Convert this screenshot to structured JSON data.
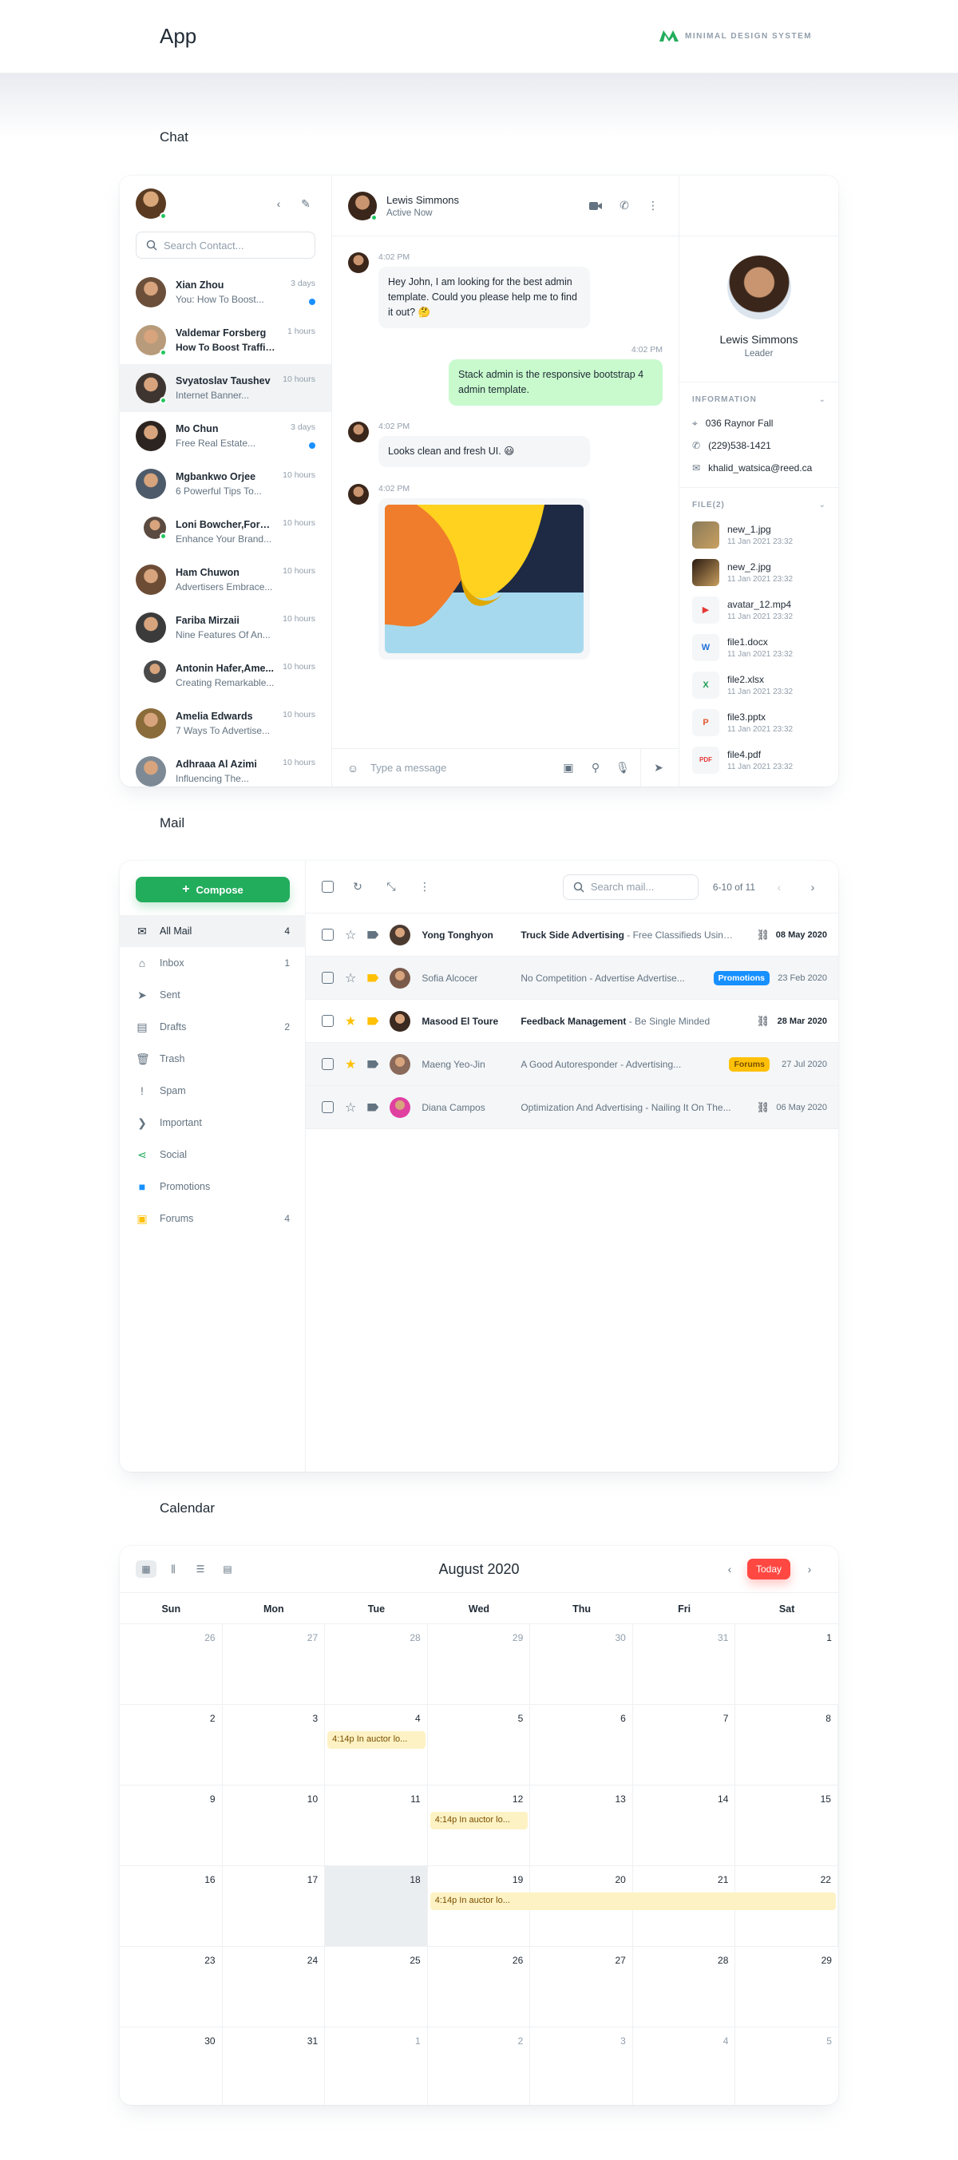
{
  "header": {
    "title": "App",
    "brand": "MINIMAL DESIGN SYSTEM"
  },
  "sections": {
    "chat": "Chat",
    "mail": "Mail",
    "calendar": "Calendar"
  },
  "chat": {
    "search_placeholder": "Search Contact...",
    "contacts": [
      {
        "name": "Xian Zhou",
        "msg": "You: How To Boost...",
        "time": "3 days",
        "unread": true,
        "bold": false,
        "color": "#6b4f3a"
      },
      {
        "name": "Valdemar Forsberg",
        "msg": "How To Boost Traffic...",
        "time": "1 hours",
        "unread": false,
        "bold": true,
        "online": true,
        "color": "#b89b7a"
      },
      {
        "name": "Svyatoslav Taushev",
        "msg": "Internet Banner...",
        "time": "10 hours",
        "unread": false,
        "active": true,
        "online": true,
        "color": "#3e3530"
      },
      {
        "name": "Mo Chun",
        "msg": "Free Real Estate...",
        "time": "3 days",
        "unread": true,
        "color": "#2c2420"
      },
      {
        "name": "Mgbankwo Orjee",
        "msg": "6 Powerful Tips To...",
        "time": "10 hours",
        "color": "#4d5a6a"
      },
      {
        "name": "Loni Bowcher,Forsb...",
        "msg": "Enhance Your Brand...",
        "time": "10 hours",
        "group": true,
        "online": true,
        "color": "#5a4a40"
      },
      {
        "name": "Ham Chuwon",
        "msg": "Advertisers Embrace...",
        "time": "10 hours",
        "color": "#6d4c36"
      },
      {
        "name": "Fariba Mirzaii",
        "msg": "Nine Features Of An...",
        "time": "10 hours",
        "color": "#3b3b3b"
      },
      {
        "name": "Antonin Hafer,Ame...",
        "msg": "Creating Remarkable...",
        "time": "10 hours",
        "group": true,
        "color": "#4a4a4a"
      },
      {
        "name": "Amelia Edwards",
        "msg": "7 Ways To Advertise...",
        "time": "10 hours",
        "color": "#8a6b3a"
      },
      {
        "name": "Adhraaa Al Azimi",
        "msg": "Influencing The...",
        "time": "10 hours",
        "color": "#7d8a95"
      }
    ],
    "conversation": {
      "name": "Lewis Simmons",
      "status": "Active Now",
      "messages": [
        {
          "time": "4:02 PM",
          "text": "Hey John, I am looking for the best admin template. Could you please help me to find it out? 🤔",
          "me": false
        },
        {
          "time": "4:02 PM",
          "text": "Stack admin is the responsive bootstrap 4 admin template.",
          "me": true
        },
        {
          "time": "4:02 PM",
          "text": "Looks clean and fresh UI. 😃",
          "me": false
        },
        {
          "time": "4:02 PM",
          "text": "",
          "me": false,
          "image": true
        }
      ],
      "composer_placeholder": "Type a message"
    },
    "profile": {
      "name": "Lewis Simmons",
      "role": "Leader",
      "info_label": "INFORMATION",
      "address": "036 Raynor Fall",
      "phone": "(229)538-1421",
      "email": "khalid_watsica@reed.ca",
      "files_label": "FILE(2)",
      "files": [
        {
          "name": "new_1.jpg",
          "date": "11 Jan 2021 23:32",
          "kind": "img1",
          "color": "#8a7a5a"
        },
        {
          "name": "new_2.jpg",
          "date": "11 Jan 2021 23:32",
          "kind": "img2",
          "color": "#2a1a10"
        },
        {
          "name": "avatar_12.mp4",
          "date": "11 Jan 2021 23:32",
          "kind": "video",
          "color": "#e53935",
          "glyph": "▶"
        },
        {
          "name": "file1.docx",
          "date": "11 Jan 2021 23:32",
          "kind": "doc",
          "color": "#1e6fd9",
          "glyph": "W"
        },
        {
          "name": "file2.xlsx",
          "date": "11 Jan 2021 23:32",
          "kind": "xls",
          "color": "#1d9d53",
          "glyph": "X"
        },
        {
          "name": "file3.pptx",
          "date": "11 Jan 2021 23:32",
          "kind": "ppt",
          "color": "#e4572e",
          "glyph": "P"
        },
        {
          "name": "file4.pdf",
          "date": "11 Jan 2021 23:32",
          "kind": "pdf",
          "color": "#e53935",
          "glyph": "PDF"
        }
      ]
    }
  },
  "mail": {
    "compose": "Compose",
    "labels": [
      {
        "name": "All Mail",
        "count": "4",
        "icon": "✉",
        "color": "#212b36",
        "active": true
      },
      {
        "name": "Inbox",
        "count": "1",
        "icon": "⌂",
        "color": "#637381"
      },
      {
        "name": "Sent",
        "count": "",
        "icon": "➤",
        "color": "#637381"
      },
      {
        "name": "Drafts",
        "count": "2",
        "icon": "▤",
        "color": "#637381"
      },
      {
        "name": "Trash",
        "count": "",
        "icon": "🗑",
        "color": "#637381"
      },
      {
        "name": "Spam",
        "count": "",
        "icon": "!",
        "color": "#637381"
      },
      {
        "name": "Important",
        "count": "",
        "icon": "❯",
        "color": "#637381"
      },
      {
        "name": "Social",
        "count": "",
        "icon": "⋖",
        "color": "#22ad5c"
      },
      {
        "name": "Promotions",
        "count": "",
        "icon": "■",
        "color": "#1890ff"
      },
      {
        "name": "Forums",
        "count": "4",
        "icon": "▣",
        "color": "#ffc107"
      }
    ],
    "search_placeholder": "Search mail...",
    "pagination": "6-10 of 11",
    "rows": [
      {
        "name": "Yong Tonghyon",
        "subject": "Truck Side Advertising",
        "snippet": " - Free Classifieds Using...",
        "date": "08 May 2020",
        "unread": true,
        "starred": false,
        "tag": "#637381",
        "attach": true,
        "badge": "",
        "badge_color": "",
        "color": "#4a3a30"
      },
      {
        "name": "Sofia Alcocer",
        "subject": "No Competition",
        "snippet": " - Advertise Advertise...",
        "date": "23 Feb 2020",
        "unread": false,
        "starred": false,
        "tag": "#ffc107",
        "attach": false,
        "badge": "Promotions",
        "badge_color": "#1890ff",
        "color": "#7a5a4a"
      },
      {
        "name": "Masood El Toure",
        "subject": "Feedback Management",
        "snippet": " - Be Single Minded",
        "date": "28 Mar 2020",
        "unread": true,
        "starred": true,
        "tag": "#ffc107",
        "attach": true,
        "badge": "",
        "badge_color": "",
        "color": "#3a2a20"
      },
      {
        "name": "Maeng Yeo-Jin",
        "subject": "A Good Autoresponder",
        "snippet": " - Advertising...",
        "date": "27 Jul 2020",
        "unread": false,
        "starred": true,
        "tag": "#637381",
        "attach": false,
        "badge": "Forums",
        "badge_color": "#ffc107",
        "color": "#8a6a5a"
      },
      {
        "name": "Diana Campos",
        "subject": "Optimization And Advertising",
        "snippet": " - Nailing It On The...",
        "date": "06 May 2020",
        "unread": false,
        "starred": false,
        "tag": "#637381",
        "attach": true,
        "badge": "",
        "badge_color": "",
        "color": "#e040a0"
      }
    ]
  },
  "calendar": {
    "title": "August 2020",
    "today": "Today",
    "weekdays": [
      "Sun",
      "Mon",
      "Tue",
      "Wed",
      "Thu",
      "Fri",
      "Sat"
    ],
    "weeks": [
      [
        "26",
        "27",
        "28",
        "29",
        "30",
        "31",
        "1"
      ],
      [
        "2",
        "3",
        "4",
        "5",
        "6",
        "7",
        "8"
      ],
      [
        "9",
        "10",
        "11",
        "12",
        "13",
        "14",
        "15"
      ],
      [
        "16",
        "17",
        "18",
        "19",
        "20",
        "21",
        "22"
      ],
      [
        "23",
        "24",
        "25",
        "26",
        "27",
        "28",
        "29"
      ],
      [
        "30",
        "31",
        "1",
        "2",
        "3",
        "4",
        "5"
      ]
    ],
    "events": [
      {
        "text": "4:14p In auctor lo...",
        "week": 1,
        "start": 2,
        "span": 1
      },
      {
        "text": "4:14p In auctor lo...",
        "week": 2,
        "start": 3,
        "span": 1
      },
      {
        "text": "4:14p In auctor lo...",
        "week": 3,
        "start": 3,
        "span": 4
      }
    ]
  }
}
